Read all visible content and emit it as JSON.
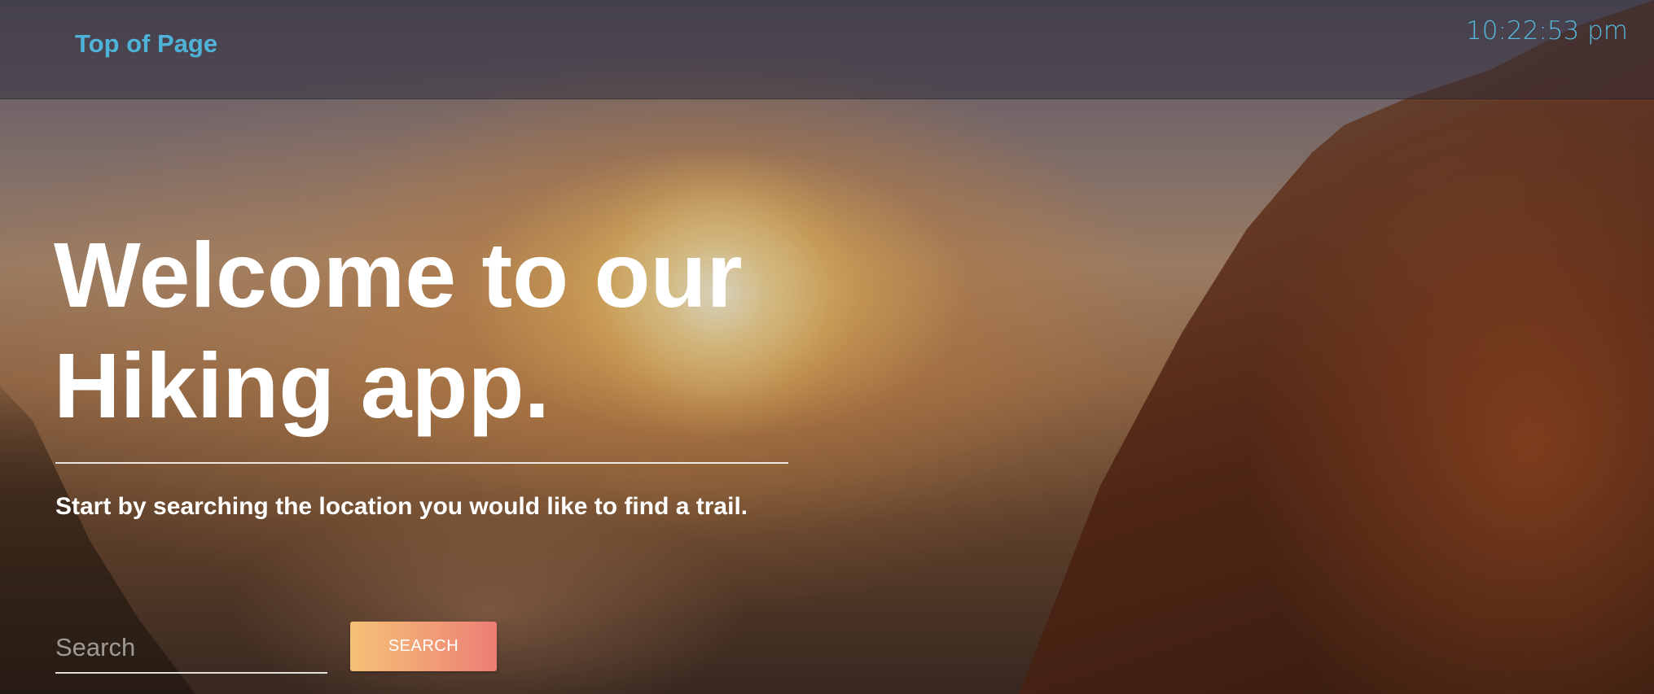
{
  "nav": {
    "top_link": "Top of Page",
    "clock": "10:22:53 pm"
  },
  "hero": {
    "title_line1": "Welcome to our",
    "title_line2": "Hiking app.",
    "subtitle": "Start by searching the location you would like to find a trail."
  },
  "search": {
    "placeholder": "Search",
    "value": "",
    "button_label": "SEARCH"
  },
  "colors": {
    "link": "#4fb3d9",
    "button_gradient_start": "#f6c177",
    "button_gradient_end": "#ee7d75",
    "hero_text": "#ffffff"
  },
  "background": {
    "icon": "mountain-sunset-photo"
  }
}
